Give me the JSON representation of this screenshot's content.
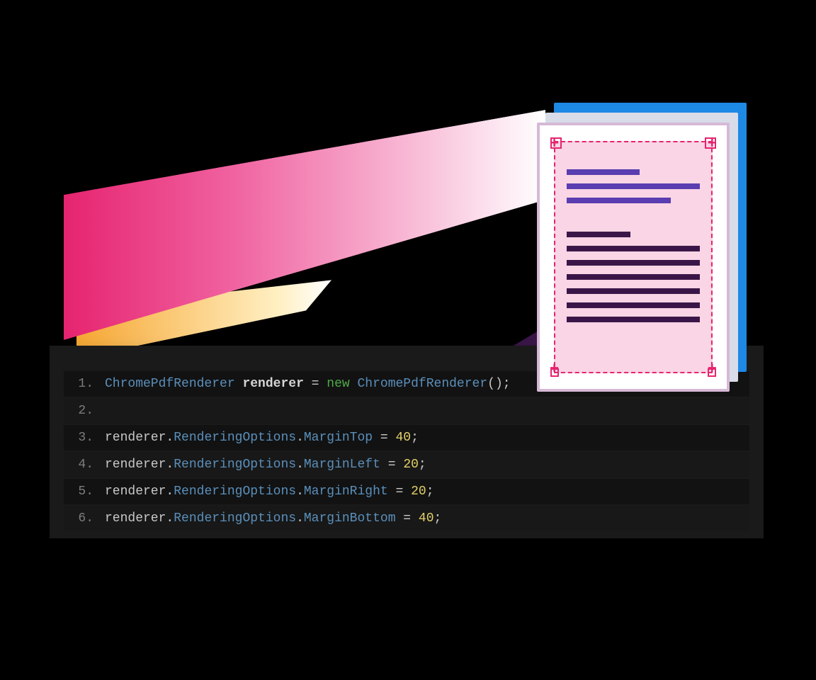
{
  "colors": {
    "beam_start": "#e6246f",
    "beam_end": "#ffffff",
    "accent_yellow": "#f7a21a",
    "doc_blue": "#1e88e5",
    "doc_purple_line": "#5a3db0",
    "doc_dark_line": "#3a1648",
    "margin_dash": "#e6246f",
    "code_bg": "#1a1a1a"
  },
  "document_illustration": {
    "margin_marker": "dashed",
    "corner_glyph": "+"
  },
  "code": {
    "lines": [
      {
        "n": "1.",
        "tokens": [
          {
            "t": "ChromePdfRenderer",
            "c": "t-type"
          },
          {
            "t": " ",
            "c": "t-plain"
          },
          {
            "t": "renderer",
            "c": "t-ident"
          },
          {
            "t": " = ",
            "c": "t-op"
          },
          {
            "t": "new",
            "c": "t-kw"
          },
          {
            "t": " ",
            "c": "t-plain"
          },
          {
            "t": "ChromePdfRenderer",
            "c": "t-type"
          },
          {
            "t": "();",
            "c": "t-punc"
          }
        ]
      },
      {
        "n": "2.",
        "tokens": []
      },
      {
        "n": "3.",
        "tokens": [
          {
            "t": "renderer",
            "c": "t-plain"
          },
          {
            "t": ".",
            "c": "t-punc"
          },
          {
            "t": "RenderingOptions",
            "c": "t-type"
          },
          {
            "t": ".",
            "c": "t-punc"
          },
          {
            "t": "MarginTop",
            "c": "t-type"
          },
          {
            "t": " = ",
            "c": "t-op"
          },
          {
            "t": "40",
            "c": "t-num"
          },
          {
            "t": ";",
            "c": "t-punc"
          }
        ]
      },
      {
        "n": "4.",
        "tokens": [
          {
            "t": "renderer",
            "c": "t-plain"
          },
          {
            "t": ".",
            "c": "t-punc"
          },
          {
            "t": "RenderingOptions",
            "c": "t-type"
          },
          {
            "t": ".",
            "c": "t-punc"
          },
          {
            "t": "MarginLeft",
            "c": "t-type"
          },
          {
            "t": " = ",
            "c": "t-op"
          },
          {
            "t": "20",
            "c": "t-num"
          },
          {
            "t": ";",
            "c": "t-punc"
          }
        ]
      },
      {
        "n": "5.",
        "tokens": [
          {
            "t": "renderer",
            "c": "t-plain"
          },
          {
            "t": ".",
            "c": "t-punc"
          },
          {
            "t": "RenderingOptions",
            "c": "t-type"
          },
          {
            "t": ".",
            "c": "t-punc"
          },
          {
            "t": "MarginRight",
            "c": "t-type"
          },
          {
            "t": " = ",
            "c": "t-op"
          },
          {
            "t": "20",
            "c": "t-num"
          },
          {
            "t": ";",
            "c": "t-punc"
          }
        ]
      },
      {
        "n": "6.",
        "tokens": [
          {
            "t": "renderer",
            "c": "t-plain"
          },
          {
            "t": ".",
            "c": "t-punc"
          },
          {
            "t": "RenderingOptions",
            "c": "t-type"
          },
          {
            "t": ".",
            "c": "t-punc"
          },
          {
            "t": "MarginBottom",
            "c": "t-type"
          },
          {
            "t": " = ",
            "c": "t-op"
          },
          {
            "t": "40",
            "c": "t-num"
          },
          {
            "t": ";",
            "c": "t-punc"
          }
        ]
      }
    ]
  }
}
